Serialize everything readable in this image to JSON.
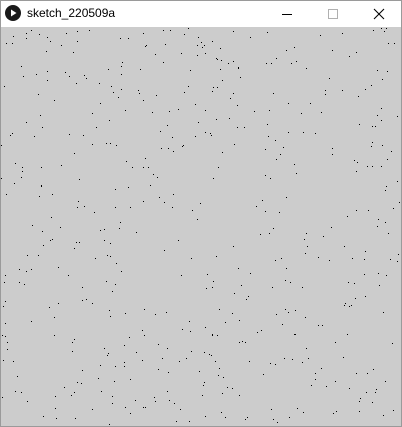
{
  "window": {
    "title": "sketch_220509a"
  },
  "icons": {
    "app": "processing-play-icon",
    "minimize": "minimize-icon",
    "maximize": "maximize-icon",
    "close": "close-icon"
  },
  "canvas": {
    "background": "#cccccc",
    "point_color": "#000000"
  }
}
